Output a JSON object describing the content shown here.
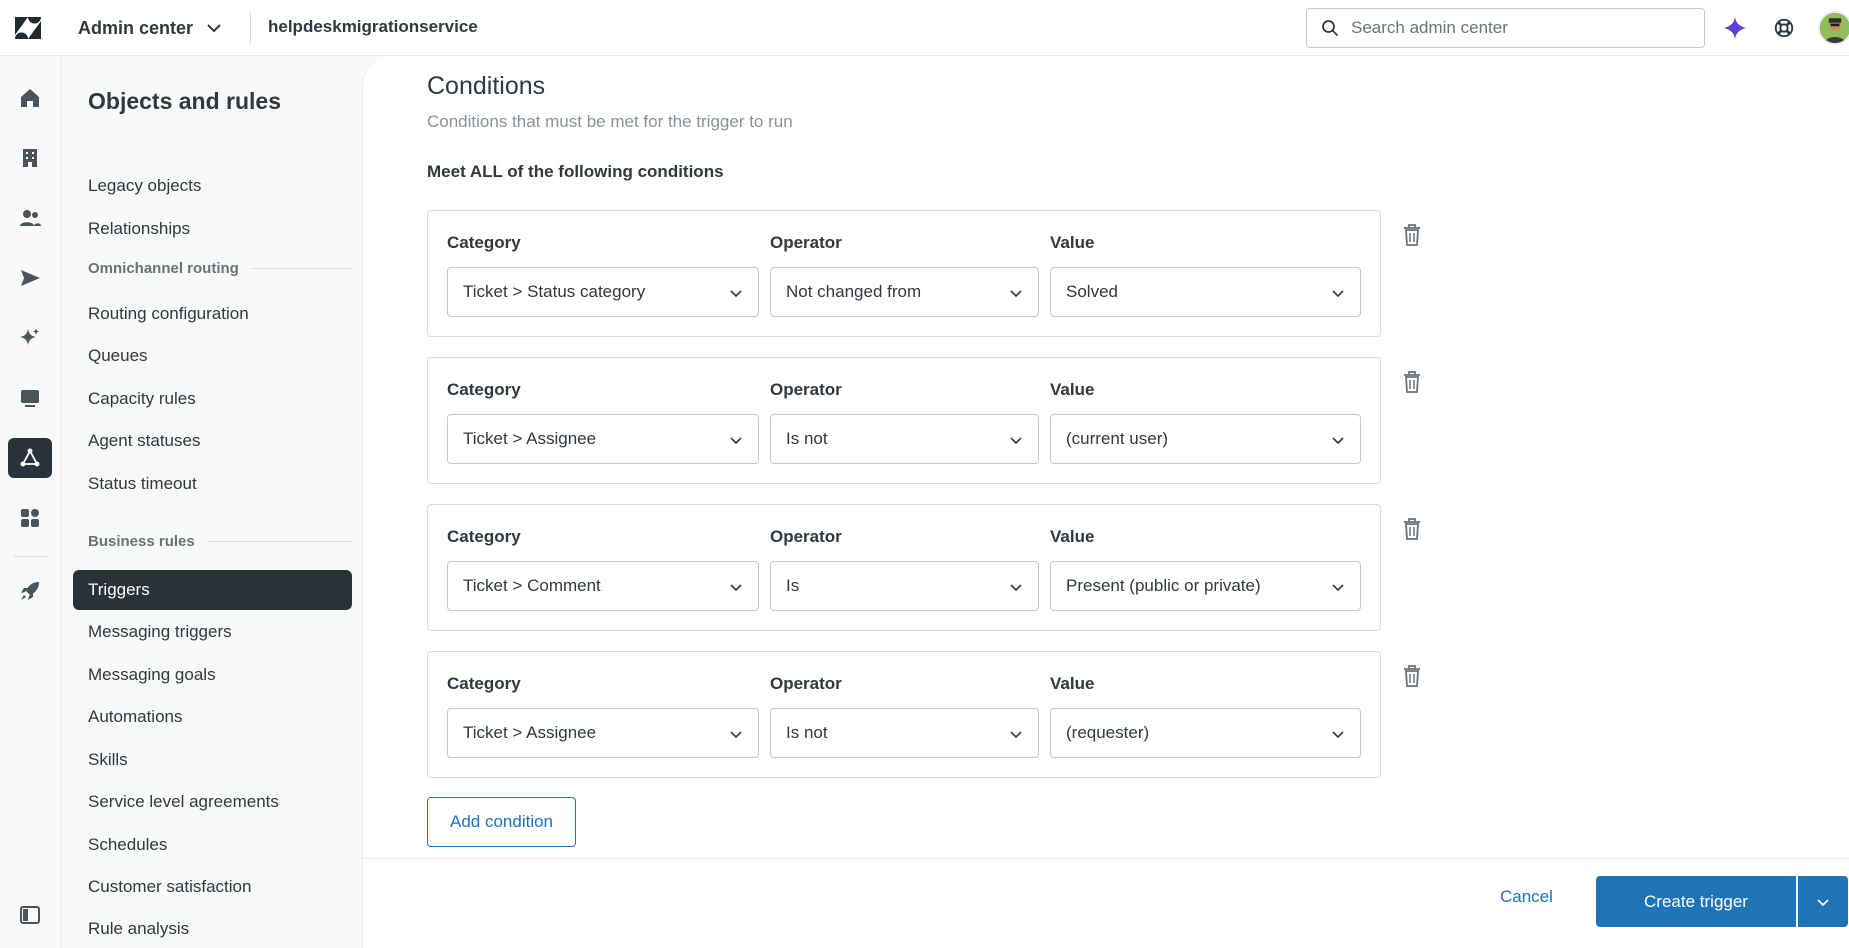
{
  "header": {
    "product_name": "Admin center",
    "subdomain": "helpdeskmigrationservice",
    "search_placeholder": "Search admin center"
  },
  "rail": {
    "icons": [
      "home-icon",
      "building-icon",
      "people-icon",
      "channels-send-icon",
      "ai-sparkle-icon",
      "workspaces-icon",
      "objects-rules-icon",
      "apps-integrations-icon",
      "rocket-icon",
      "panel-toggle-icon"
    ],
    "active": "objects-rules-icon"
  },
  "nav": {
    "title": "Objects and rules",
    "items_top": [
      "Legacy objects",
      "Relationships"
    ],
    "section_omnichannel": "Omnichannel routing",
    "items_omnichannel": [
      "Routing configuration",
      "Queues",
      "Capacity rules",
      "Agent statuses",
      "Status timeout"
    ],
    "section_business": "Business rules",
    "items_business": [
      "Triggers",
      "Messaging triggers",
      "Messaging goals",
      "Automations",
      "Skills",
      "Service level agreements",
      "Schedules",
      "Customer satisfaction",
      "Rule analysis"
    ],
    "active_item": "Triggers"
  },
  "conditions": {
    "title": "Conditions",
    "description": "Conditions that must be met for the trigger to run",
    "meet_all_label": "Meet ALL of the following conditions",
    "labels": {
      "category": "Category",
      "operator": "Operator",
      "value": "Value"
    },
    "rows": [
      {
        "category": "Ticket > Status category",
        "operator": "Not changed from",
        "value": "Solved"
      },
      {
        "category": "Ticket > Assignee",
        "operator": "Is not",
        "value": "(current user)"
      },
      {
        "category": "Ticket > Comment",
        "operator": "Is",
        "value": "Present (public or private)"
      },
      {
        "category": "Ticket > Assignee",
        "operator": "Is not",
        "value": "(requester)"
      }
    ],
    "add_button": "Add condition"
  },
  "footer": {
    "cancel": "Cancel",
    "create": "Create trigger"
  },
  "colors": {
    "accent": "#1f73b7",
    "active_nav_bg": "#293239",
    "ai_icon": "#5d3fd3"
  }
}
